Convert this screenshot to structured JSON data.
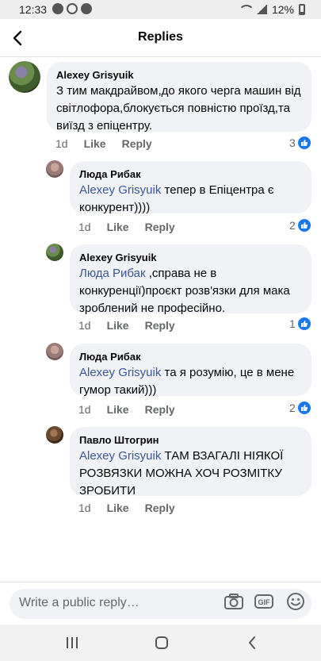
{
  "status_bar": {
    "time": "12:33",
    "battery": "12%"
  },
  "header": {
    "title": "Replies"
  },
  "comments": [
    {
      "author": "Alexey Grisyuik",
      "mention": "",
      "text": "З тим макдрайвом,до якого черга машин від світлофора,блокується повністю проїзд,та виїзд з епіцентру.",
      "time": "1d",
      "like": "Like",
      "reply": "Reply",
      "reactions": "3"
    },
    {
      "author": "Люда Рибак",
      "mention": "Alexey Grisyuik",
      "text": " тепер в Епіцентра є конкурент))))",
      "time": "1d",
      "like": "Like",
      "reply": "Reply",
      "reactions": "2"
    },
    {
      "author": "Alexey Grisyuik",
      "mention": "Люда Рибак",
      "text": " ,справа не в конкуренції)проєкт розв'язки для мака зроблений не професійно.",
      "time": "1d",
      "like": "Like",
      "reply": "Reply",
      "reactions": "1"
    },
    {
      "author": "Люда Рибак",
      "mention": "Alexey Grisyuik",
      "text": " та я розумію, це в мене гумор такий)))",
      "time": "1d",
      "like": "Like",
      "reply": "Reply",
      "reactions": "2"
    },
    {
      "author": "Павло Штогрин",
      "mention": "Alexey Grisyuik",
      "text": " ТАМ ВЗАГАЛІ НІЯКОЇ РОЗВЯЗКИ МОЖНА ХОЧ РОЗМІТКУ ЗРОБИТИ",
      "time": "1d",
      "like": "Like",
      "reply": "Reply",
      "reactions": ""
    }
  ],
  "composer": {
    "placeholder": "Write a public reply…"
  },
  "colors": {
    "link": "#385898",
    "bubble": "#f0f2f5",
    "like_blue": "#1877f2"
  }
}
